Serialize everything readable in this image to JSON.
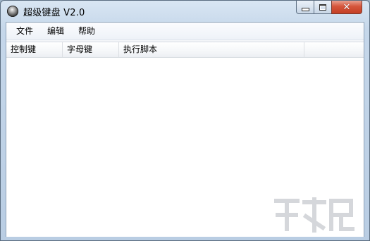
{
  "window": {
    "title": "超级键盘 V2.0"
  },
  "controls": {
    "minimize_icon": "minimize-icon",
    "maximize_icon": "maximize-icon",
    "close_icon": "close-icon",
    "close_glyph": "✕"
  },
  "menu": {
    "items": [
      {
        "label": "文件"
      },
      {
        "label": "编辑"
      },
      {
        "label": "帮助"
      }
    ]
  },
  "list": {
    "columns": [
      {
        "label": "控制键"
      },
      {
        "label": "字母键"
      },
      {
        "label": "执行脚本"
      },
      {
        "label": ""
      }
    ],
    "rows": []
  },
  "colors": {
    "close_button": "#c43f25",
    "title_gradient": "#c5d7ea",
    "list_background": "#ffffff"
  }
}
